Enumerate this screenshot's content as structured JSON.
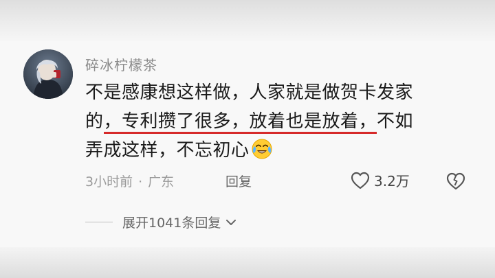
{
  "comment": {
    "username": "碎冰柠檬茶",
    "text_line1": "不是感康想这样做，人家就是做贺卡发家",
    "text_line2_prefix": "的",
    "text_line2_underlined": "，专利攒了很多，放着也是放着，",
    "text_line2_suffix": "不如",
    "text_line3": "弄成这样，不忘初心",
    "emoji": "laughing-crying-emoji",
    "time": "3小时前",
    "separator": "·",
    "location": "广东",
    "reply_label": "回复",
    "like_count": "3.2万",
    "expand_replies_label": "展开1041条回复",
    "underline_color": "#d62a2a"
  }
}
